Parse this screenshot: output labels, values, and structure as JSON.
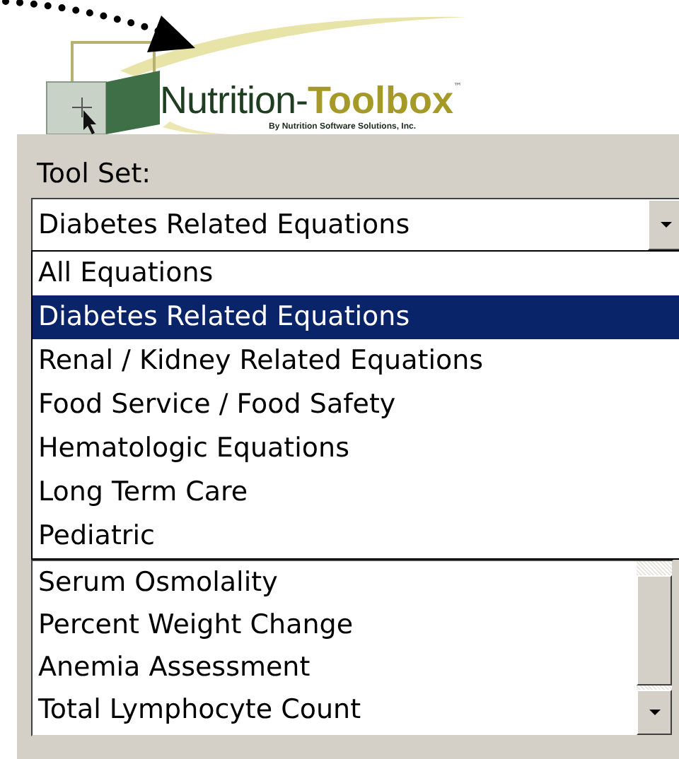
{
  "logo": {
    "name_part": "Nutrition-",
    "highlight_part": "Toolbox",
    "trademark": "™",
    "tagline": "By Nutrition Software Solutions, Inc."
  },
  "tool_set": {
    "label": "Tool Set:",
    "value": "Diabetes Related Equations",
    "expanded": true,
    "options": [
      {
        "label": "All Equations",
        "selected": false
      },
      {
        "label": "Diabetes Related Equations",
        "selected": true
      },
      {
        "label": "Renal / Kidney Related Equations",
        "selected": false
      },
      {
        "label": "Food Service / Food Safety",
        "selected": false
      },
      {
        "label": "Hematologic Equations",
        "selected": false
      },
      {
        "label": "Long Term Care",
        "selected": false
      },
      {
        "label": "Pediatric",
        "selected": false
      }
    ]
  },
  "tools": {
    "items": [
      "Serum Osmolality",
      "Percent Weight Change",
      "Anemia Assessment",
      "Total Lymphocyte Count"
    ]
  }
}
